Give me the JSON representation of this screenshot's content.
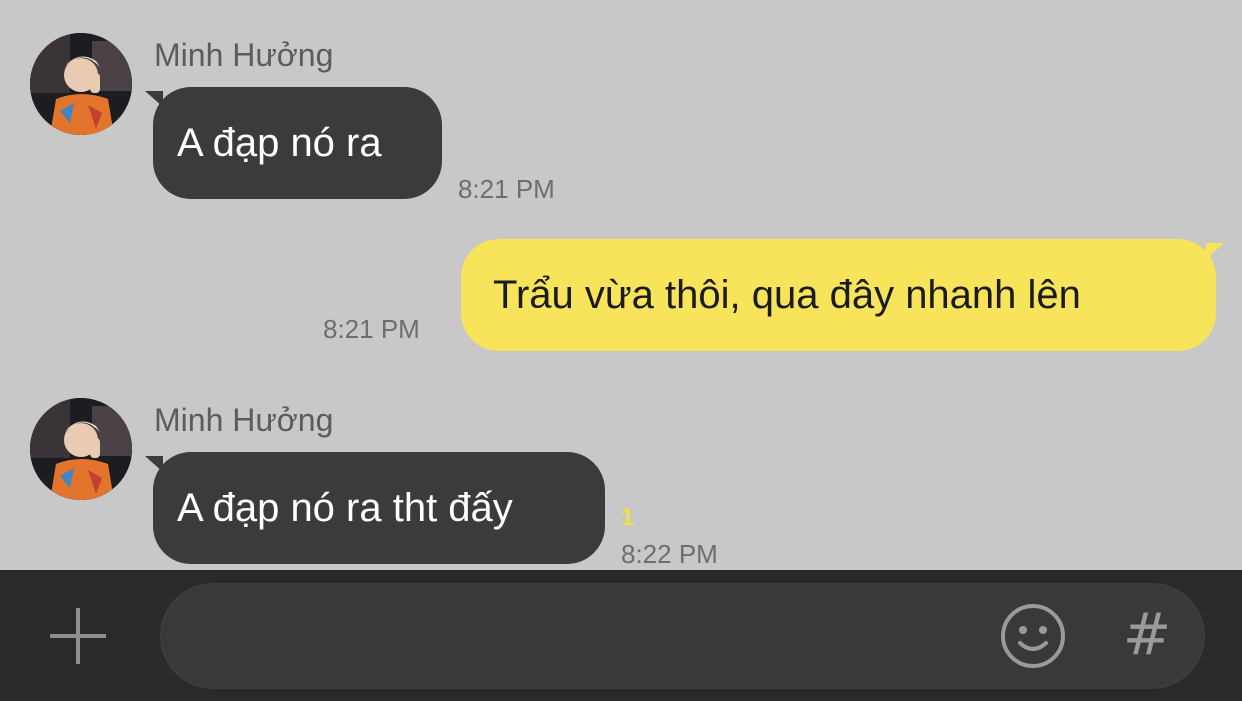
{
  "messages": [
    {
      "direction": "incoming",
      "sender": "Minh Hưởng",
      "text": "A đạp nó ra",
      "time": "8:21 PM",
      "avatar_icon": "profile-photo"
    },
    {
      "direction": "outgoing",
      "text": "Trẩu vừa thôi, qua đây nhanh lên",
      "time": "8:21 PM"
    },
    {
      "direction": "incoming",
      "sender": "Minh Hưởng",
      "text": "A đạp nó ra tht đấy",
      "time": "8:22 PM",
      "unread_count": "1",
      "avatar_icon": "profile-photo"
    }
  ],
  "composer": {
    "input_value": "",
    "input_placeholder": "",
    "plus_icon": "plus-icon",
    "emoji_icon": "emoji-icon",
    "hash_label": "#"
  },
  "colors": {
    "chat_background": "#c8c8c8",
    "incoming_bubble": "#3b3b3e",
    "outgoing_bubble": "#f7e45b",
    "composer_background": "#2a2a2a",
    "unread_accent": "#f3e046"
  }
}
